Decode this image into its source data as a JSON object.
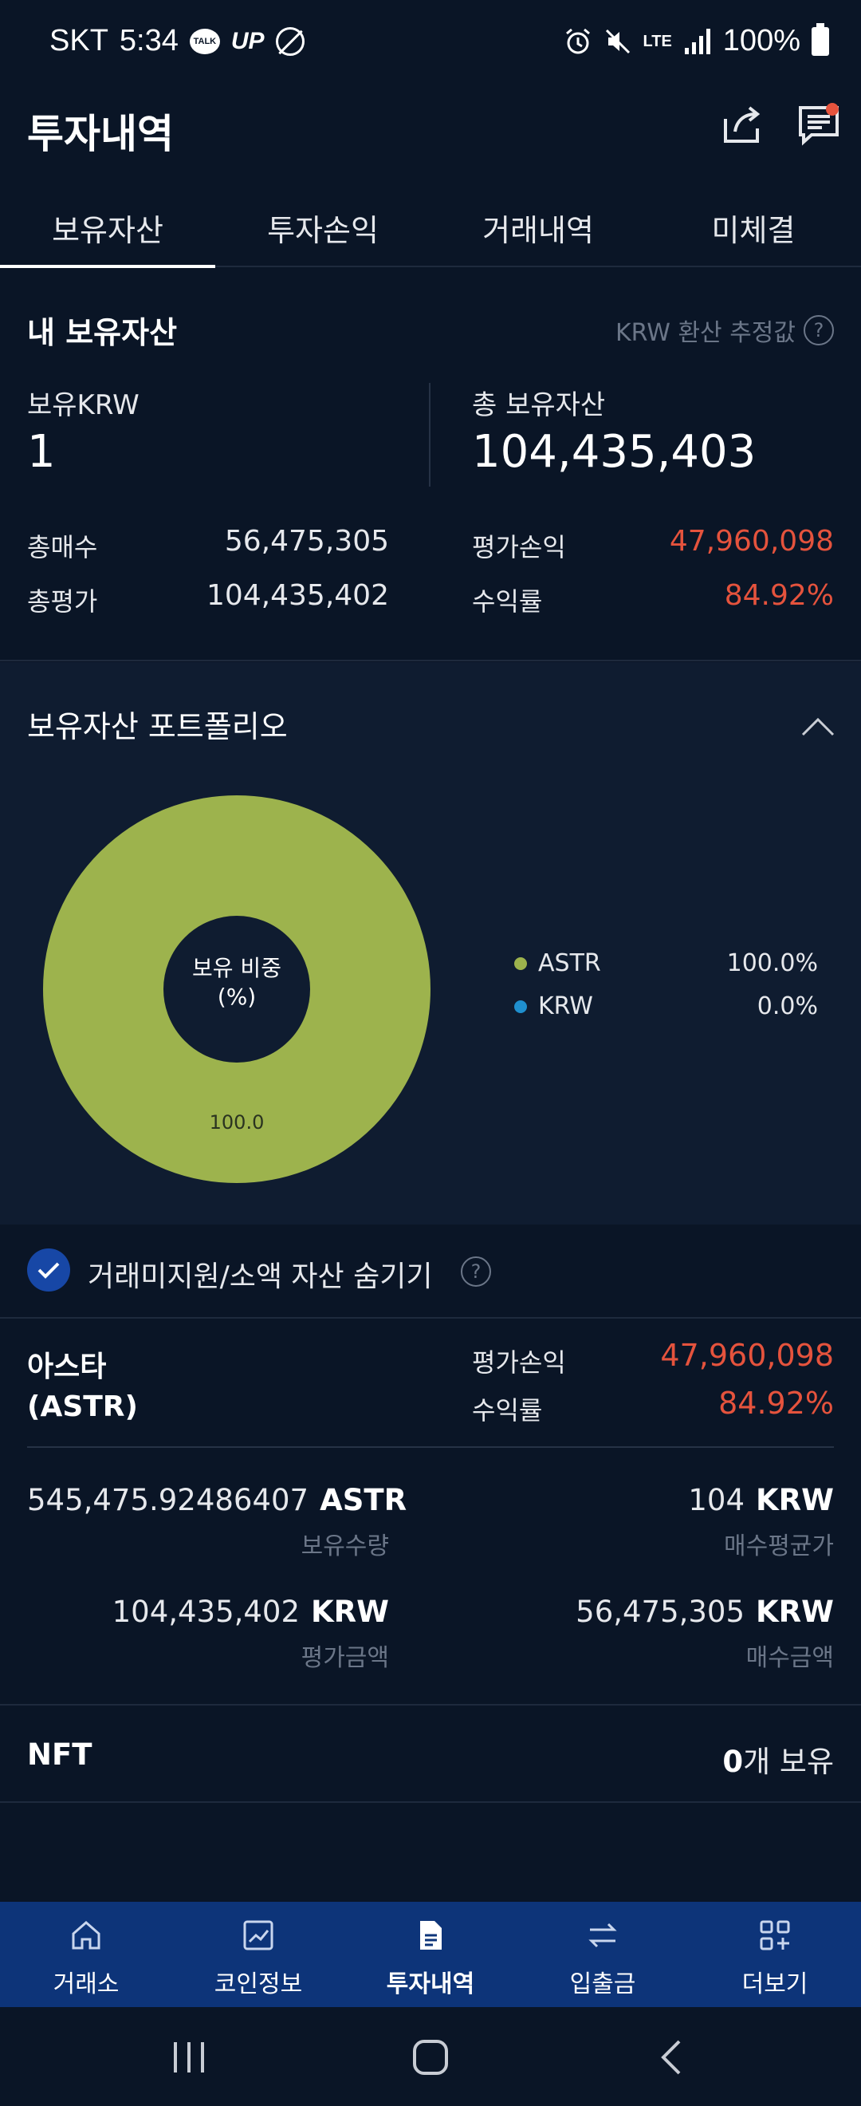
{
  "status_bar": {
    "carrier": "SKT",
    "time": "5:34",
    "talk_badge": "TALK",
    "up_badge": "UP",
    "network": "LTE",
    "battery": "100%"
  },
  "header": {
    "title": "투자내역"
  },
  "tabs": [
    {
      "label": "보유자산",
      "active": true
    },
    {
      "label": "투자손익",
      "active": false
    },
    {
      "label": "거래내역",
      "active": false
    },
    {
      "label": "미체결",
      "active": false
    }
  ],
  "summary": {
    "title": "내 보유자산",
    "krw_note": "KRW 환산 추정값",
    "held_krw_label": "보유KRW",
    "held_krw_value": "1",
    "total_assets_label": "총 보유자산",
    "total_assets_value": "104,435,403",
    "total_buy_label": "총매수",
    "total_buy_value": "56,475,305",
    "total_eval_label": "총평가",
    "total_eval_value": "104,435,402",
    "pnl_label": "평가손익",
    "pnl_value": "47,960,098",
    "return_label": "수익률",
    "return_value": "84.92%"
  },
  "portfolio": {
    "title": "보유자산 포트폴리오",
    "donut_center_line1": "보유 비중",
    "donut_center_line2": "(%)",
    "slice_label": "100.0",
    "legend": [
      {
        "name": "ASTR",
        "value": "100.0%",
        "color": "#9db34d"
      },
      {
        "name": "KRW",
        "value": "0.0%",
        "color": "#1f8fce"
      }
    ]
  },
  "chart_data": {
    "type": "pie",
    "categories": [
      "ASTR",
      "KRW"
    ],
    "values": [
      100.0,
      0.0
    ],
    "title": "보유자산 포트폴리오"
  },
  "hide_row": {
    "label": "거래미지원/소액 자산 숨기기",
    "checked": true
  },
  "asset": {
    "name_line1": "아스타",
    "name_line2": "(ASTR)",
    "pnl_label": "평가손익",
    "pnl_value": "47,960,098",
    "return_label": "수익률",
    "return_value": "84.92%",
    "quantity_value": "545,475.92486407",
    "quantity_unit": "ASTR",
    "quantity_label": "보유수량",
    "avg_price_value": "104",
    "avg_price_unit": "KRW",
    "avg_price_label": "매수평균가",
    "eval_amount_value": "104,435,402",
    "eval_amount_unit": "KRW",
    "eval_amount_label": "평가금액",
    "buy_amount_value": "56,475,305",
    "buy_amount_unit": "KRW",
    "buy_amount_label": "매수금액"
  },
  "nft": {
    "title": "NFT",
    "count": "0",
    "count_suffix": "개 보유"
  },
  "bottom_nav": [
    {
      "label": "거래소",
      "icon": "home-icon",
      "active": false
    },
    {
      "label": "코인정보",
      "icon": "chart-icon",
      "active": false
    },
    {
      "label": "투자내역",
      "icon": "document-icon",
      "active": true
    },
    {
      "label": "입출금",
      "icon": "transfer-icon",
      "active": false
    },
    {
      "label": "더보기",
      "icon": "grid-plus-icon",
      "active": false
    }
  ],
  "colors": {
    "background": "#0a1526",
    "accent_red": "#e5533d",
    "nav_blue": "#0d3479",
    "astr_green": "#9db34d",
    "krw_blue": "#1f8fce"
  }
}
